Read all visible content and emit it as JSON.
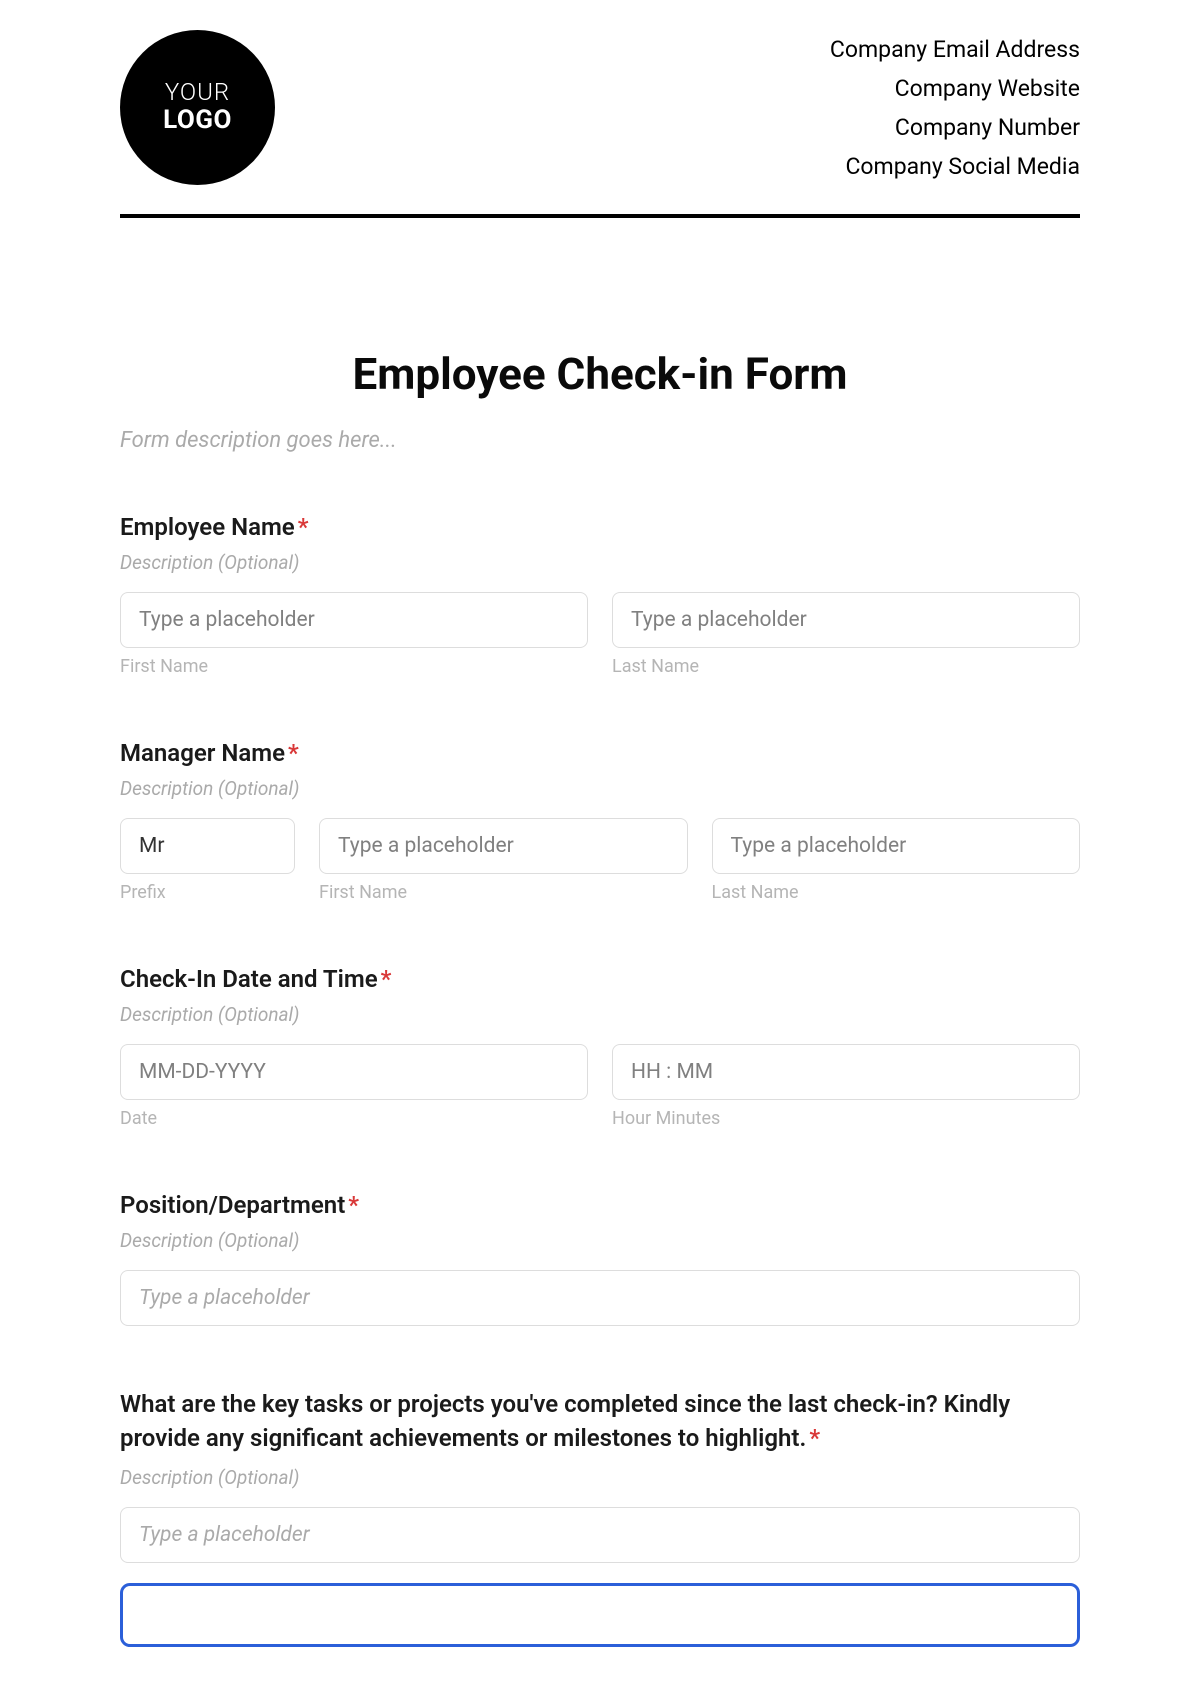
{
  "header": {
    "logo": {
      "line1": "YOUR",
      "line2": "LOGO"
    },
    "company": {
      "email": "Company Email Address",
      "website": "Company Website",
      "number": "Company Number",
      "social": "Company Social Media"
    }
  },
  "form": {
    "title": "Employee Check-in Form",
    "description": "Form description goes here...",
    "desc_optional": "Description (Optional)",
    "placeholder_generic": "Type a placeholder",
    "labels": {
      "first_name": "First Name",
      "last_name": "Last Name",
      "prefix": "Prefix",
      "date": "Date",
      "hour_min": "Hour Minutes"
    },
    "fields": {
      "employee_name": {
        "label": "Employee Name"
      },
      "manager_name": {
        "label": "Manager Name",
        "prefix_value": "Mr"
      },
      "checkin_datetime": {
        "label": "Check-In Date and Time",
        "date_placeholder": "MM-DD-YYYY",
        "time_placeholder": "HH : MM"
      },
      "position": {
        "label": "Position/Department"
      },
      "key_tasks": {
        "label": "What are the key tasks or projects you've completed since the last check-in? Kindly provide any significant achievements or milestones to highlight."
      }
    }
  }
}
